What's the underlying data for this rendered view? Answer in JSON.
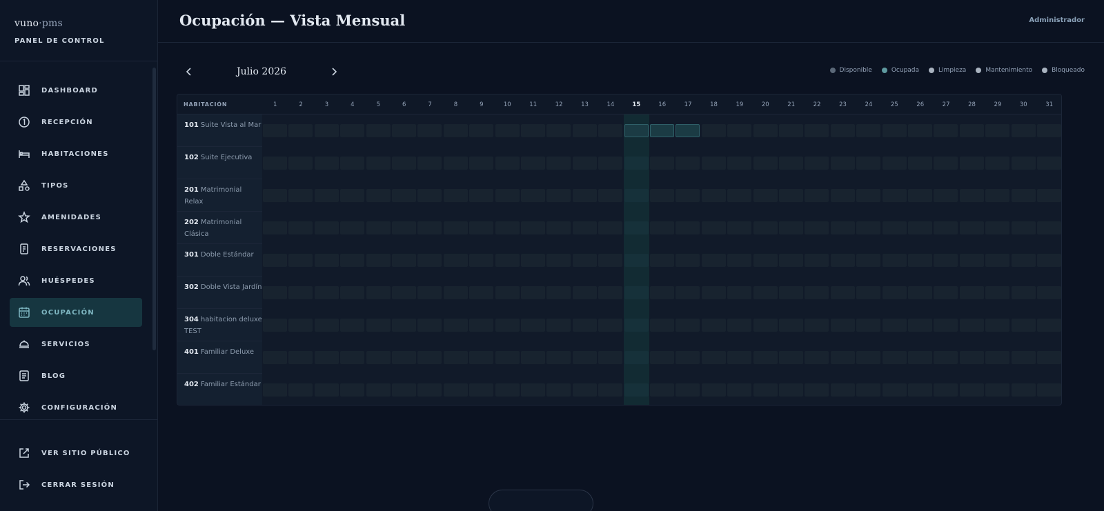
{
  "brand": {
    "logo_main": "vuno",
    "logo_sep": "·",
    "logo_suffix": "pms",
    "subtitle": "PANEL DE CONTROL"
  },
  "sidebar": {
    "items": [
      {
        "key": "dashboard",
        "label": "DASHBOARD",
        "icon": "grid-icon",
        "active": false
      },
      {
        "key": "recepcion",
        "label": "RECEPCIÓN",
        "icon": "circle-one-icon",
        "active": false
      },
      {
        "key": "habitaciones",
        "label": "HABITACIONES",
        "icon": "bed-icon",
        "active": false
      },
      {
        "key": "tipos",
        "label": "TIPOS",
        "icon": "shapes-icon",
        "active": false
      },
      {
        "key": "amenidades",
        "label": "AMENIDADES",
        "icon": "star-icon",
        "active": false
      },
      {
        "key": "reservaciones",
        "label": "RESERVACIONES",
        "icon": "document-icon",
        "active": false
      },
      {
        "key": "huespedes",
        "label": "HUÉSPEDES",
        "icon": "users-icon",
        "active": false
      },
      {
        "key": "ocupacion",
        "label": "OCUPACIÓN",
        "icon": "calendar-icon",
        "active": true
      },
      {
        "key": "servicios",
        "label": "SERVICIOS",
        "icon": "cloche-icon",
        "active": false
      },
      {
        "key": "blog",
        "label": "BLOG",
        "icon": "article-icon",
        "active": false
      },
      {
        "key": "configuracion",
        "label": "CONFIGURACIÓN",
        "icon": "gear-icon",
        "active": false
      }
    ],
    "bottom": [
      {
        "key": "sitio",
        "label": "VER SITIO PÚBLICO",
        "icon": "external-link-icon"
      },
      {
        "key": "logout",
        "label": "CERRAR SESIÓN",
        "icon": "logout-icon"
      }
    ]
  },
  "header": {
    "title": "Ocupación — Vista Mensual",
    "user": "Administrador"
  },
  "calendar": {
    "month_label": "Julio 2026",
    "room_column_header": "HABITACIÓN",
    "days": [
      1,
      2,
      3,
      4,
      5,
      6,
      7,
      8,
      9,
      10,
      11,
      12,
      13,
      14,
      15,
      16,
      17,
      18,
      19,
      20,
      21,
      22,
      23,
      24,
      25,
      26,
      27,
      28,
      29,
      30,
      31
    ],
    "today": 15,
    "rooms": [
      {
        "number": "101",
        "name": "Suite Vista al Mar",
        "occupied_days": [
          15,
          16,
          17
        ]
      },
      {
        "number": "102",
        "name": "Suite Ejecutiva",
        "occupied_days": []
      },
      {
        "number": "201",
        "name": "Matrimonial Relax",
        "occupied_days": []
      },
      {
        "number": "202",
        "name": "Matrimonial Clásica",
        "occupied_days": []
      },
      {
        "number": "301",
        "name": "Doble Estándar",
        "occupied_days": []
      },
      {
        "number": "302",
        "name": "Doble Vista Jardín",
        "occupied_days": []
      },
      {
        "number": "304",
        "name": "habitacion deluxe TEST",
        "occupied_days": []
      },
      {
        "number": "401",
        "name": "Familiar Deluxe",
        "occupied_days": []
      },
      {
        "number": "402",
        "name": "Familiar Estándar",
        "occupied_days": []
      }
    ]
  },
  "legend": [
    {
      "label": "Disponible",
      "color": "#5b6878"
    },
    {
      "label": "Ocupada",
      "color": "#5f9aa0"
    },
    {
      "label": "Limpieza",
      "color": "#a9b3c0"
    },
    {
      "label": "Mantenimiento",
      "color": "#a9b3c0"
    },
    {
      "label": "Bloqueado",
      "color": "#a9b3c0"
    }
  ],
  "colors": {
    "background": "#0b1221",
    "accent": "#7fb7c2",
    "occupied": "#1b3b44"
  }
}
